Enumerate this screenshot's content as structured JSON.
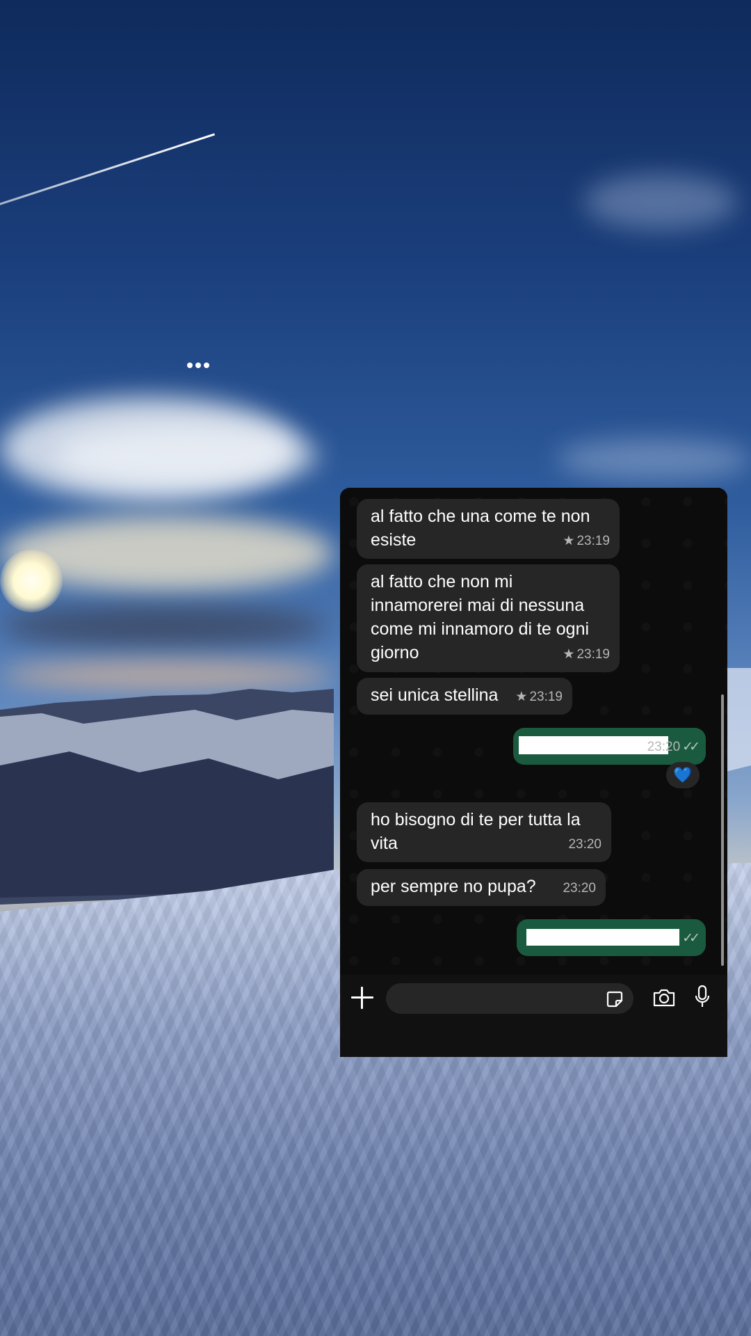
{
  "story": {
    "dots": "•••"
  },
  "chat": {
    "messages": [
      {
        "direction": "in",
        "text": "al fatto che una come te non esiste",
        "starred": true,
        "time": "23:19"
      },
      {
        "direction": "in",
        "text": "al fatto che non mi innamorerei mai di nessuna come mi innamoro di te ogni giorno",
        "starred": true,
        "time": "23:19"
      },
      {
        "direction": "in",
        "text": "sei unica stellina",
        "starred": true,
        "time": "23:19"
      },
      {
        "direction": "out",
        "text": "",
        "redacted": true,
        "time": "23:20",
        "reaction": "💙"
      },
      {
        "direction": "in",
        "text": "ho bisogno di te per tutta la vita",
        "time": "23:20"
      },
      {
        "direction": "in",
        "text": "per sempre no pupa?",
        "time": "23:20"
      },
      {
        "direction": "out",
        "text": "",
        "redacted": true,
        "time": ""
      }
    ],
    "star_glyph": "★",
    "read_ticks": "✓✓",
    "input_bar": {
      "attach_icon": "plus-icon",
      "sticker_icon": "sticker-icon",
      "camera_icon": "camera-icon",
      "mic_icon": "microphone-icon"
    }
  },
  "colors": {
    "incoming_bubble": "#262626",
    "outgoing_bubble": "#1a5b3f",
    "chat_background": "#0c0c0c",
    "meta_text": "#b6b6b6"
  }
}
